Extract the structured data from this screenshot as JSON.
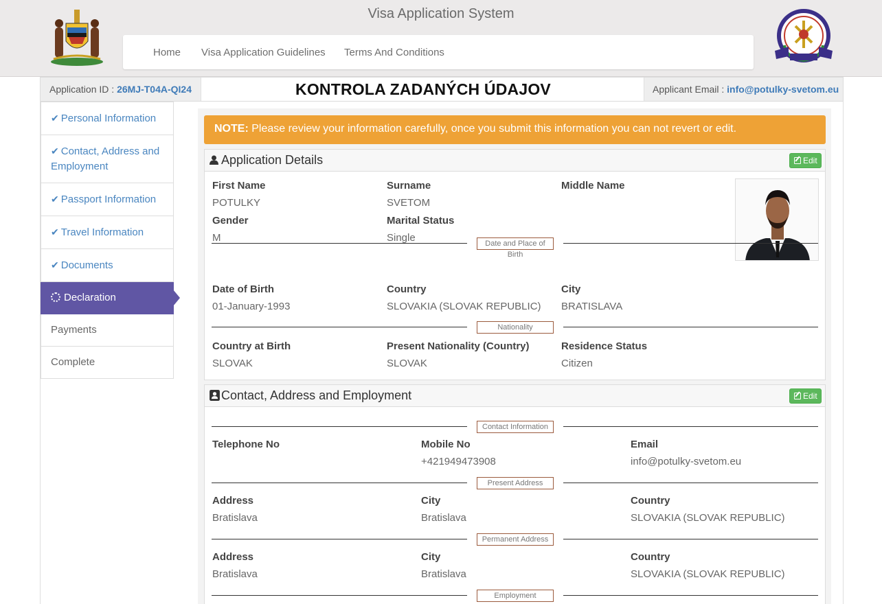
{
  "site": {
    "title": "Visa Application System"
  },
  "nav": {
    "items": [
      "Home",
      "Visa Application Guidelines",
      "Terms And Conditions"
    ]
  },
  "infobar": {
    "app_id_label": "Application ID :",
    "app_id": "26MJ-T04A-QI24",
    "heading": "KONTROLA ZADANÝCH ÚDAJOV",
    "email_label": "Applicant Email :",
    "email": "info@potulky-svetom.eu"
  },
  "sidebar": {
    "items": [
      {
        "label": "Personal Information",
        "state": "done"
      },
      {
        "label": "Contact, Address and Employment",
        "state": "done"
      },
      {
        "label": "Passport Information",
        "state": "done"
      },
      {
        "label": "Travel Information",
        "state": "done"
      },
      {
        "label": "Documents",
        "state": "done"
      },
      {
        "label": "Declaration",
        "state": "active"
      },
      {
        "label": "Payments",
        "state": "pending"
      },
      {
        "label": "Complete",
        "state": "pending"
      }
    ]
  },
  "note": {
    "prefix": "NOTE:",
    "text": "Please review your information carefully, once you submit this information you can not revert or edit."
  },
  "application_details": {
    "title": "Application Details",
    "edit_label": "Edit",
    "first_name": {
      "label": "First Name",
      "value": "POTULKY"
    },
    "surname": {
      "label": "Surname",
      "value": "SVETOM"
    },
    "middle_name": {
      "label": "Middle Name",
      "value": ""
    },
    "gender": {
      "label": "Gender",
      "value": "M"
    },
    "marital_status": {
      "label": "Marital Status",
      "value": "Single"
    },
    "divider_birth": "Date and Place of Birth",
    "date_of_birth": {
      "label": "Date of Birth",
      "value": "01-January-1993"
    },
    "country": {
      "label": "Country",
      "value": "SLOVAKIA (SLOVAK REPUBLIC)"
    },
    "city": {
      "label": "City",
      "value": "BRATISLAVA"
    },
    "divider_nationality": "Nationality",
    "country_at_birth": {
      "label": "Country at Birth",
      "value": "SLOVAK"
    },
    "present_nationality": {
      "label": "Present Nationality (Country)",
      "value": "SLOVAK"
    },
    "residence_status": {
      "label": "Residence Status",
      "value": "Citizen"
    }
  },
  "contact": {
    "title": "Contact, Address and Employment",
    "edit_label": "Edit",
    "divider_contact": "Contact Information",
    "telephone": {
      "label": "Telephone No",
      "value": ""
    },
    "mobile": {
      "label": "Mobile No",
      "value": "+421949473908"
    },
    "email": {
      "label": "Email",
      "value": "info@potulky-svetom.eu"
    },
    "divider_present": "Present Address",
    "present_address": {
      "label": "Address",
      "value": "Bratislava"
    },
    "present_city": {
      "label": "City",
      "value": "Bratislava"
    },
    "present_country": {
      "label": "Country",
      "value": "SLOVAKIA (SLOVAK REPUBLIC)"
    },
    "divider_permanent": "Permanent Address",
    "permanent_address": {
      "label": "Address",
      "value": "Bratislava"
    },
    "permanent_city": {
      "label": "City",
      "value": "Bratislava"
    },
    "permanent_country": {
      "label": "Country",
      "value": "SLOVAKIA (SLOVAK REPUBLIC)"
    },
    "divider_employment": "Employment"
  },
  "icons": {
    "check": "check-icon",
    "spinner": "spinner-icon",
    "user": "user-icon",
    "contact_card": "contact-card-icon",
    "edit": "edit-icon"
  },
  "colors": {
    "primary_link": "#4a86c0",
    "active_step": "#6056a4",
    "note_bg": "#eea236",
    "edit_button": "#5cb85c"
  }
}
